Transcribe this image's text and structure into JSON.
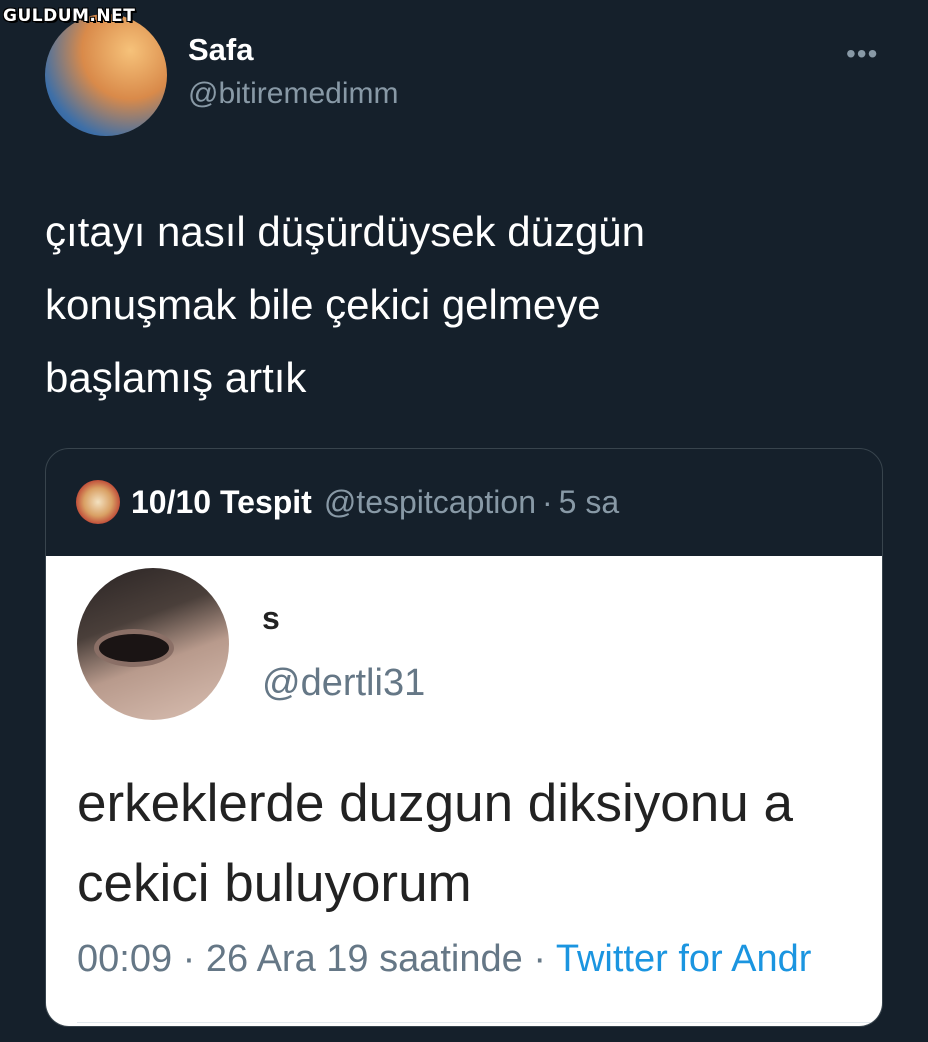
{
  "watermark": "GULDUM.NET",
  "tweet": {
    "author_name": "Safa",
    "author_handle": "@bitiremedimm",
    "more_label": "•••",
    "text_lines": [
      "çıtayı nasıl düşürdüysek düzgün",
      "konuşmak bile çekici gelmeye",
      "başlamış artık"
    ]
  },
  "quote": {
    "author_name": "10/10 Tespit",
    "author_handle": "@tespitcaption",
    "separator": "·",
    "time": "5 sa",
    "screenshot": {
      "name": "s",
      "handle": "@dertli31",
      "text_lines": [
        "erkeklerde duzgun diksiyonu a",
        "cekici buluyorum"
      ],
      "meta_time": "00:09 · 26 Ara 19 saatinde · ",
      "meta_source": "Twitter for Andr"
    }
  }
}
